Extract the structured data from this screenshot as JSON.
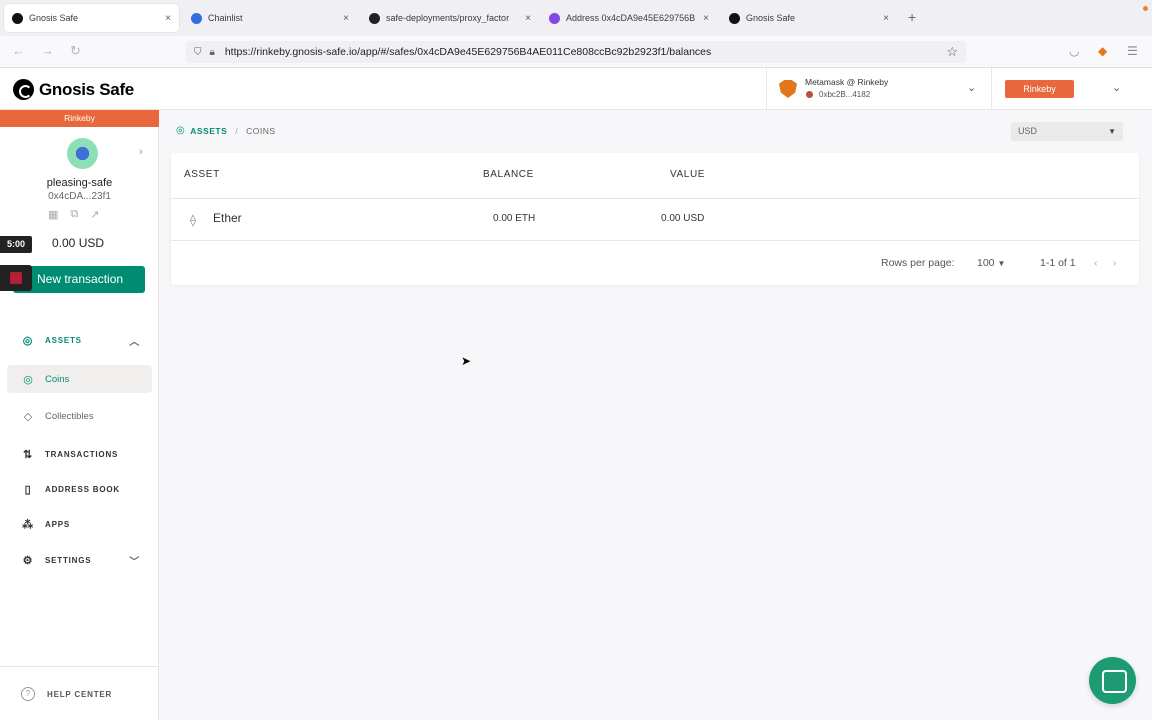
{
  "browser": {
    "tabs": [
      {
        "label": "Gnosis Safe",
        "active": true,
        "icon": "gnosis-logo-icon"
      },
      {
        "label": "Chainlist",
        "active": false,
        "icon": "chainlist-icon"
      },
      {
        "label": "safe-deployments/proxy_factor",
        "active": false,
        "icon": "github-icon"
      },
      {
        "label": "Address 0x4cDA9e45E629756B",
        "active": false,
        "icon": "polygon-icon"
      },
      {
        "label": "Gnosis Safe",
        "active": false,
        "icon": "gnosis-logo-icon"
      }
    ],
    "new_tab": "+",
    "close_glyph": "×",
    "url": "https://rinkeby.gnosis-safe.io/app/#/safes/0x4cDA9e45E629756B4AE011Ce808ccBc92b2923f1/balances"
  },
  "header": {
    "logo_text": "Gnosis Safe",
    "wallet_name": "Metamask @ Rinkeby",
    "wallet_address": "0xbc2B...4182",
    "network_button": "Rinkeby",
    "colors": {
      "network": "#e8673c",
      "primary": "#008c73"
    }
  },
  "sidebar": {
    "network_label": "Rinkeby",
    "safe_name": "pleasing-safe",
    "safe_address": "0x4cDA...23f1",
    "balance": "0.00 USD",
    "timer": "5:00",
    "new_tx_label": "New transaction",
    "nav": {
      "assets": "ASSETS",
      "coins": "Coins",
      "collectibles": "Collectibles",
      "transactions": "TRANSACTIONS",
      "address_book": "ADDRESS BOOK",
      "apps": "APPS",
      "settings": "SETTINGS"
    },
    "help": "HELP CENTER"
  },
  "main": {
    "breadcrumb": {
      "assets": "ASSETS",
      "sep": "/",
      "coins": "COINS"
    },
    "currency": "USD",
    "table": {
      "headers": {
        "asset": "ASSET",
        "balance": "BALANCE",
        "value": "VALUE"
      },
      "rows": [
        {
          "asset": "Ether",
          "balance": "0.00 ETH",
          "value": "0.00 USD"
        }
      ]
    },
    "pagination": {
      "rows_per_page_label": "Rows per page:",
      "rows_per_page": "100",
      "range": "1-1 of 1"
    }
  }
}
